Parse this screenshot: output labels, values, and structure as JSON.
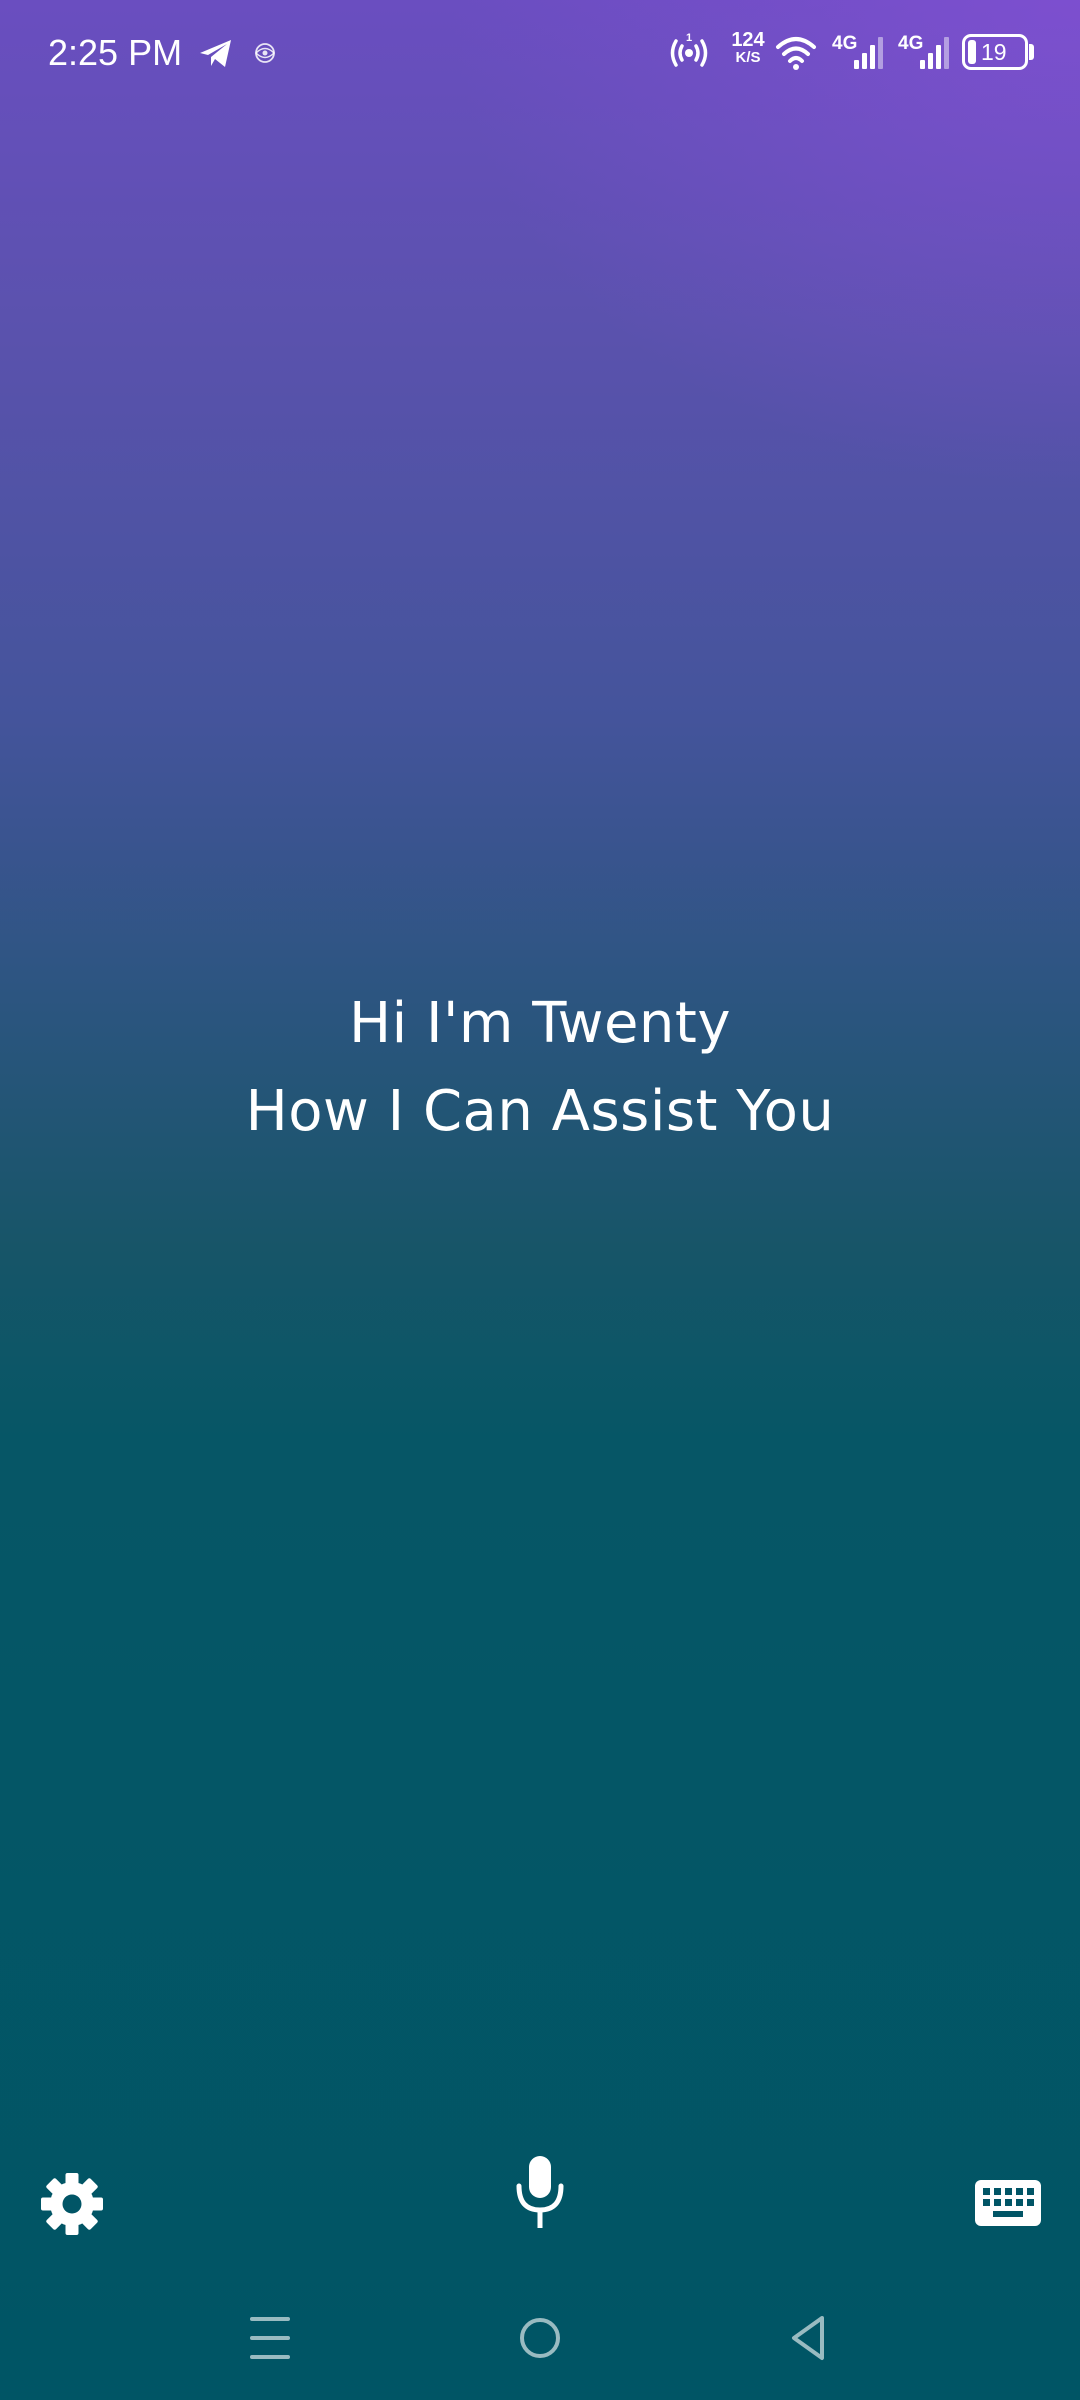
{
  "status_bar": {
    "time": "2:25 PM",
    "icons": [
      "telegram-icon",
      "app-notification-icon",
      "hotspot-icon",
      "wifi-icon",
      "signal-icon",
      "signal-icon",
      "battery-icon"
    ],
    "hotspot_badge": "1",
    "net_speed_value": "124",
    "net_speed_unit": "K/S",
    "sim1_label": "4G",
    "sim2_label": "4G",
    "battery_level": "19"
  },
  "greeting": {
    "line1": "Hi I'm Twenty",
    "line2": "How I Can Assist You"
  },
  "controls": {
    "settings_icon": "gear-icon",
    "mic_icon": "microphone-icon",
    "keyboard_icon": "keyboard-icon"
  },
  "nav_bar": {
    "icons": [
      "menu-icon",
      "home-icon",
      "back-icon"
    ]
  },
  "colors": {
    "top_gradient": "#6a4ec0",
    "bottom_background": "#005565",
    "text": "#ffffff"
  }
}
